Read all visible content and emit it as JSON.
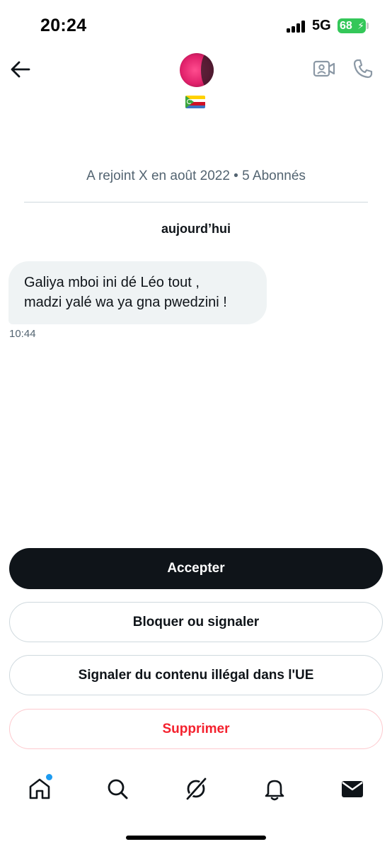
{
  "status_bar": {
    "time": "20:24",
    "network": "5G",
    "battery": "68"
  },
  "header": {
    "back_icon": "arrow-left-icon",
    "video_icon": "video-camera-icon",
    "call_icon": "phone-icon",
    "flag_icon": "comoros-flag-icon"
  },
  "profile": {
    "meta": "A rejoint X en août 2022 • 5 Abonnés"
  },
  "conversation": {
    "day_label": "aujourd’hui",
    "messages": [
      {
        "lines": [
          "Galiya mboi ini dé Léo tout ,",
          "madzi yalé wa ya gna pwedzini !"
        ],
        "time": "10:44"
      }
    ]
  },
  "actions": {
    "accept": "Accepter",
    "block_or_report": "Bloquer ou signaler",
    "report_illegal": "Signaler du contenu illégal dans l'UE",
    "delete": "Supprimer"
  },
  "bottom_nav": {
    "items": [
      "home-icon",
      "search-icon",
      "grok-icon",
      "notifications-icon",
      "messages-icon"
    ],
    "home_has_badge": true
  },
  "colors": {
    "text_primary": "#0f1419",
    "text_secondary": "#536471",
    "border": "#cfd9de",
    "bubble_bg": "#eff3f4",
    "danger": "#f4212e",
    "accent": "#1d9bf0",
    "battery": "#34c759"
  }
}
